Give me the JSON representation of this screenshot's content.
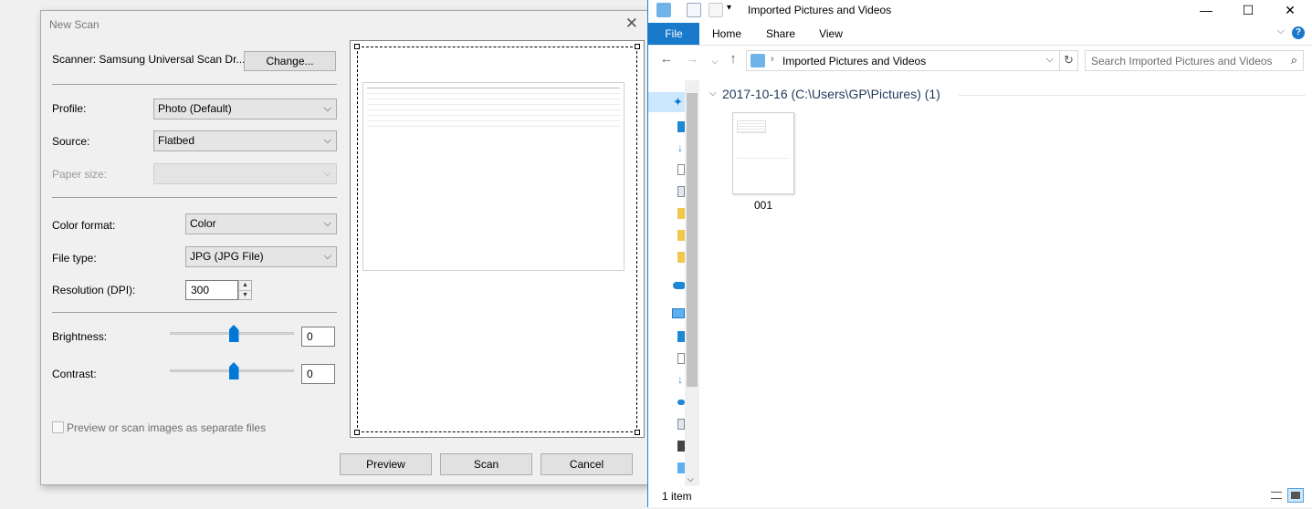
{
  "scan": {
    "title": "New Scan",
    "close_glyph": "✕",
    "scanner_label": "Scanner: Samsung Universal Scan Dr...",
    "change_button": "Change...",
    "profile": {
      "label": "Profile:",
      "value": "Photo (Default)"
    },
    "source": {
      "label": "Source:",
      "value": "Flatbed"
    },
    "paper_size": {
      "label": "Paper size:",
      "value": ""
    },
    "color_format": {
      "label": "Color format:",
      "value": "Color"
    },
    "file_type": {
      "label": "File type:",
      "value": "JPG (JPG File)"
    },
    "resolution": {
      "label": "Resolution (DPI):",
      "value": "300"
    },
    "brightness": {
      "label": "Brightness:",
      "value": "0",
      "level": 0.5
    },
    "contrast": {
      "label": "Contrast:",
      "value": "0",
      "level": 0.5
    },
    "separate_files": {
      "label": "Preview or scan images as separate files",
      "checked": false
    },
    "buttons": {
      "preview": "Preview",
      "scan": "Scan",
      "cancel": "Cancel"
    }
  },
  "explorer": {
    "title": "Imported Pictures and Videos",
    "window_buttons": {
      "minimize": "—",
      "maximize": "☐",
      "close": "✕"
    },
    "ribbon": {
      "file": "File",
      "home": "Home",
      "share": "Share",
      "view": "View",
      "help": "?"
    },
    "address": "Imported Pictures and Videos",
    "search_placeholder": "Search Imported Pictures and Videos",
    "group_header": "2017-10-16 (C:\\Users\\GP\\Pictures) (1)",
    "items": [
      {
        "name": "001"
      }
    ],
    "status": "1 item"
  },
  "colors": {
    "accent": "#0078d7",
    "file_tab": "#1979ca",
    "group_header": "#1e395b",
    "selected_nav": "#cce8ff"
  },
  "icons": [
    "close-icon",
    "chevron-down-icon",
    "spin-up-icon",
    "spin-down-icon",
    "back-arrow-icon",
    "forward-arrow-icon",
    "recent-locations-icon",
    "up-arrow-icon",
    "refresh-icon",
    "search-icon",
    "folder-icon",
    "quick-access-star-icon",
    "onedrive-icon",
    "this-pc-icon",
    "details-view-icon",
    "large-icons-view-icon"
  ]
}
